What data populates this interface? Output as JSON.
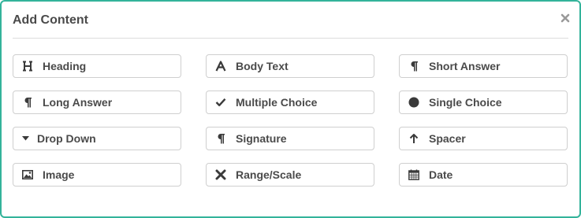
{
  "dialog": {
    "title": "Add Content",
    "close_icon": "close-icon",
    "accent_color": "#33b39a"
  },
  "items": [
    {
      "label": "Heading",
      "icon": "heading-icon"
    },
    {
      "label": "Body Text",
      "icon": "font-icon"
    },
    {
      "label": "Short Answer",
      "icon": "paragraph-icon"
    },
    {
      "label": "Long Answer",
      "icon": "paragraph-icon"
    },
    {
      "label": "Multiple Choice",
      "icon": "check-icon"
    },
    {
      "label": "Single Choice",
      "icon": "circle-icon"
    },
    {
      "label": "Drop Down",
      "icon": "caret-down-icon"
    },
    {
      "label": "Signature",
      "icon": "paragraph-icon"
    },
    {
      "label": "Spacer",
      "icon": "arrow-up-icon"
    },
    {
      "label": "Image",
      "icon": "image-icon"
    },
    {
      "label": "Range/Scale",
      "icon": "x-icon"
    },
    {
      "label": "Date",
      "icon": "calendar-icon"
    }
  ]
}
